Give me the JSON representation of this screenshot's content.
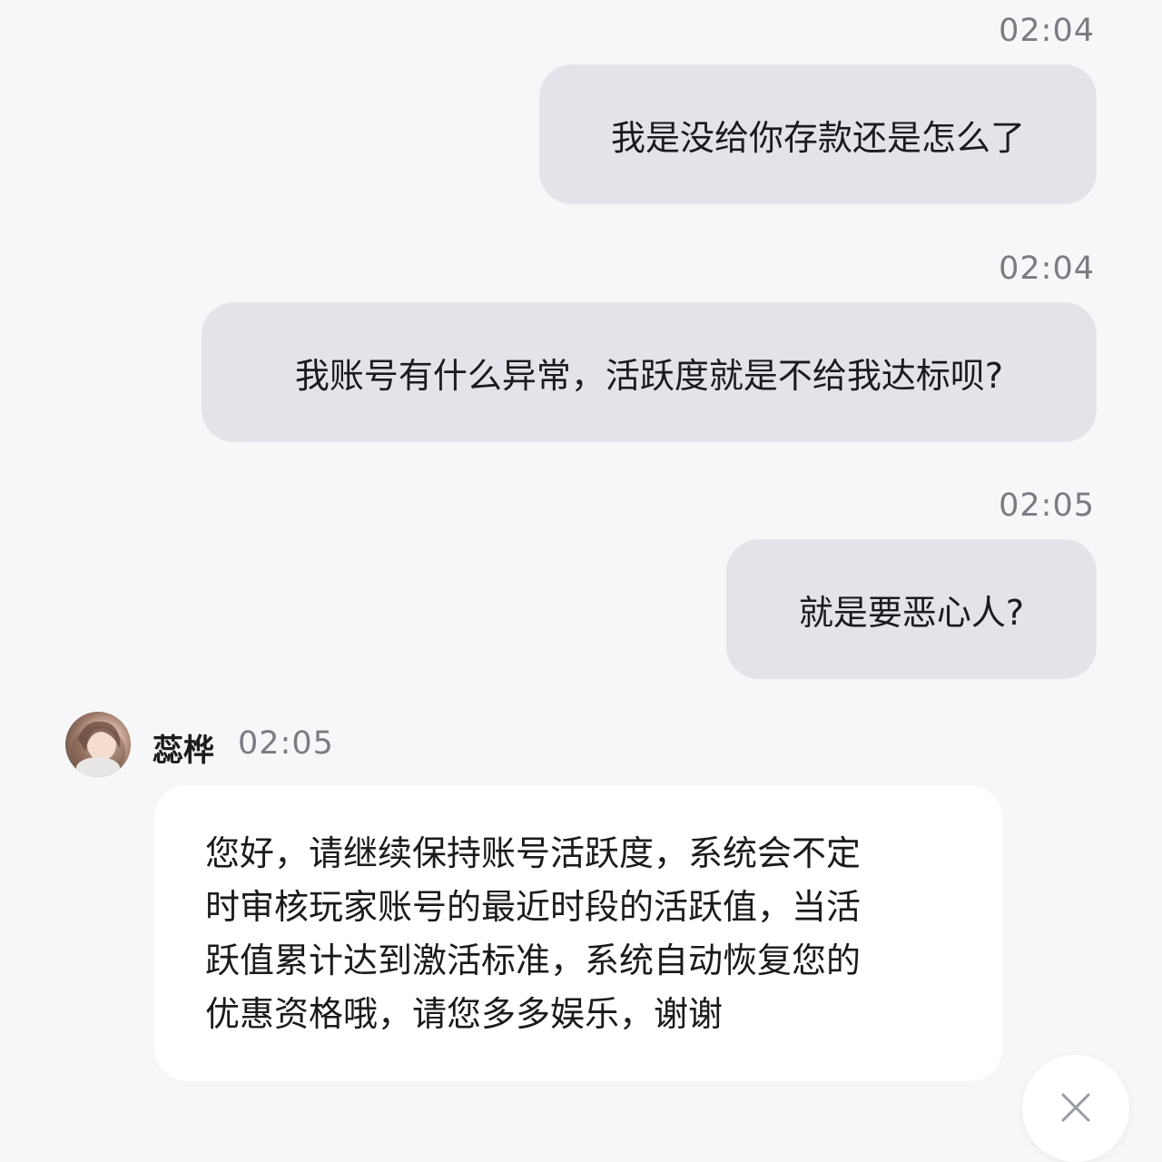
{
  "conversation": {
    "messages": [
      {
        "direction": "outgoing",
        "time": "02:04",
        "text": "我是没给你存款还是怎么了"
      },
      {
        "direction": "outgoing",
        "time": "02:04",
        "text": "我账号有什么异常，活跃度就是不给我达标呗?"
      },
      {
        "direction": "outgoing",
        "time": "02:05",
        "text": "就是要恶心人?"
      },
      {
        "direction": "incoming",
        "sender": "蕊桦",
        "time": "02:05",
        "lines": [
          "您好，请继续保持账号活跃度，系统会不定",
          "时审核玩家账号的最近时段的活跃值，当活",
          "跃值累计达到激活标准，系统自动恢复您的",
          "优惠资格哦，请您多多娱乐，谢谢"
        ]
      }
    ]
  },
  "icons": {
    "avatar": "agent-avatar",
    "close": "close-icon"
  },
  "colors": {
    "background": "#f6f7f9",
    "outgoing_bubble": "#e3e4e9",
    "incoming_bubble": "#ffffff",
    "timestamp": "#7a7c82",
    "text": "#1b1b1d"
  }
}
